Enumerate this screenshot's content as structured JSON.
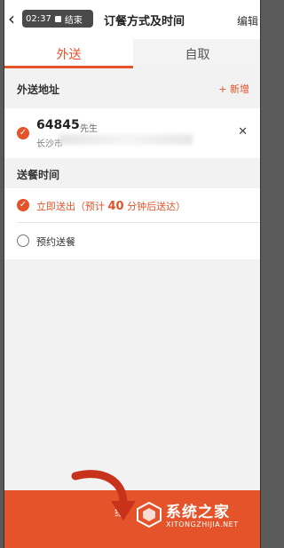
{
  "status": {
    "record_time": "02:37",
    "record_stop_label": "结束"
  },
  "header": {
    "title": "订餐方式及时间",
    "edit_label": "编辑"
  },
  "tabs": [
    {
      "label": "外送",
      "active": true
    },
    {
      "label": "自取",
      "active": false
    }
  ],
  "address_section": {
    "title": "外送地址",
    "add_label": "+ 新增",
    "address": {
      "name": "64845",
      "honorific": "先生",
      "city": "长沙市"
    }
  },
  "delivery_section": {
    "title": "送餐时间",
    "option_now": {
      "prefix": "立即送出（预计 ",
      "minutes": "40",
      "suffix": " 分钟后送达）",
      "selected": true
    },
    "option_schedule": {
      "label": "预约送餐",
      "selected": false
    }
  },
  "bottom": {
    "continue_label": "继"
  },
  "watermark": {
    "text": "系统之家",
    "sub": "XITONGZHIJIA.NET"
  },
  "colors": {
    "accent": "#e4532a",
    "background": "#f2f2f2",
    "card": "#ffffff"
  }
}
